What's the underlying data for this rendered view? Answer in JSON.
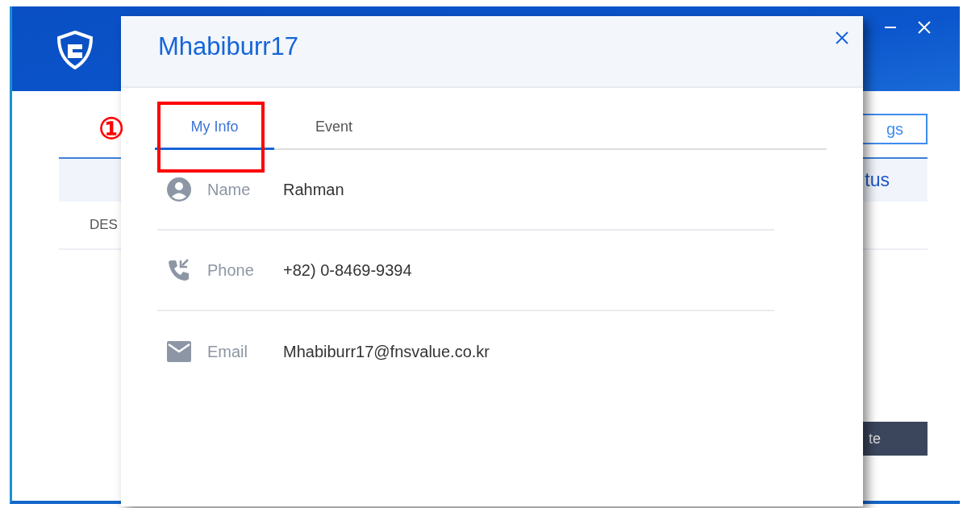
{
  "app": {
    "toolbar_button": "gs",
    "table_header": "tus",
    "table_cell": "DES",
    "action_button": "te"
  },
  "dialog": {
    "title": "Mhabiburr17",
    "tabs": [
      {
        "label": "My Info",
        "selected": true
      },
      {
        "label": "Event",
        "selected": false
      }
    ],
    "fields": [
      {
        "kind": "person",
        "label": "Name",
        "value": "Rahman"
      },
      {
        "kind": "phone",
        "label": "Phone",
        "value": "+82) 0-8469-9394"
      },
      {
        "kind": "email",
        "label": "Email",
        "value": "Mhabiburr17@fnsvalue.co.kr"
      }
    ]
  },
  "annotation": {
    "number": "①"
  }
}
